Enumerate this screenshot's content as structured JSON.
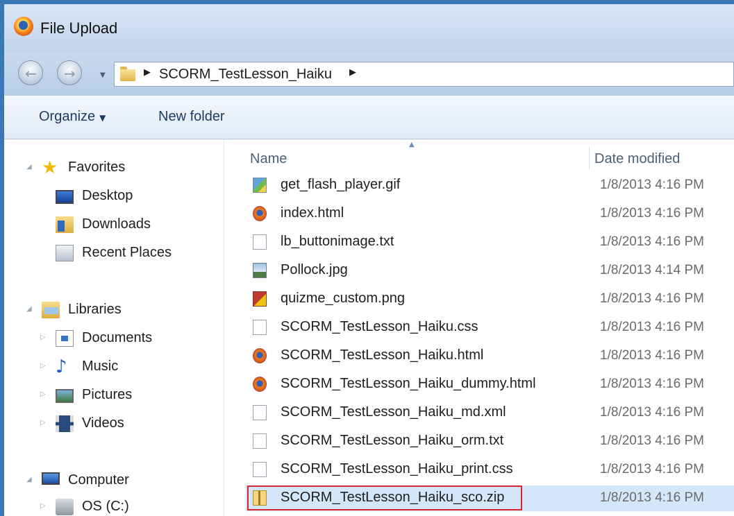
{
  "window": {
    "title": "File Upload",
    "app_icon": "firefox-icon"
  },
  "navigation": {
    "back_icon": "back-arrow-icon",
    "forward_icon": "forward-arrow-icon",
    "breadcrumb": [
      "SCORM_TestLesson_Haiku"
    ]
  },
  "toolbar": {
    "organize_label": "Organize",
    "new_folder_label": "New folder"
  },
  "sidebar": {
    "favorites": {
      "label": "Favorites",
      "icon": "star-icon",
      "items": [
        {
          "label": "Desktop",
          "icon": "desktop-icon"
        },
        {
          "label": "Downloads",
          "icon": "downloads-folder-icon"
        },
        {
          "label": "Recent Places",
          "icon": "recent-places-icon"
        }
      ]
    },
    "libraries": {
      "label": "Libraries",
      "icon": "libraries-icon",
      "items": [
        {
          "label": "Documents",
          "icon": "documents-icon"
        },
        {
          "label": "Music",
          "icon": "music-icon"
        },
        {
          "label": "Pictures",
          "icon": "pictures-icon"
        },
        {
          "label": "Videos",
          "icon": "videos-icon"
        }
      ]
    },
    "computer": {
      "label": "Computer",
      "icon": "computer-icon",
      "items": [
        {
          "label": "OS (C:)",
          "icon": "drive-icon"
        }
      ]
    }
  },
  "file_list": {
    "columns": {
      "name": "Name",
      "date_modified": "Date modified"
    },
    "sort_column": "Name",
    "files": [
      {
        "name": "get_flash_player.gif",
        "date": "1/8/2013 4:16 PM",
        "icon": "image-file-icon"
      },
      {
        "name": "index.html",
        "date": "1/8/2013 4:16 PM",
        "icon": "firefox-html-icon"
      },
      {
        "name": "lb_buttonimage.txt",
        "date": "1/8/2013 4:16 PM",
        "icon": "text-file-icon"
      },
      {
        "name": "Pollock.jpg",
        "date": "1/8/2013 4:14 PM",
        "icon": "jpg-file-icon"
      },
      {
        "name": "quizme_custom.png",
        "date": "1/8/2013 4:16 PM",
        "icon": "png-file-icon"
      },
      {
        "name": "SCORM_TestLesson_Haiku.css",
        "date": "1/8/2013 4:16 PM",
        "icon": "text-file-icon"
      },
      {
        "name": "SCORM_TestLesson_Haiku.html",
        "date": "1/8/2013 4:16 PM",
        "icon": "firefox-html-icon"
      },
      {
        "name": "SCORM_TestLesson_Haiku_dummy.html",
        "date": "1/8/2013 4:16 PM",
        "icon": "firefox-html-icon"
      },
      {
        "name": "SCORM_TestLesson_Haiku_md.xml",
        "date": "1/8/2013 4:16 PM",
        "icon": "text-file-icon"
      },
      {
        "name": "SCORM_TestLesson_Haiku_orm.txt",
        "date": "1/8/2013 4:16 PM",
        "icon": "text-file-icon"
      },
      {
        "name": "SCORM_TestLesson_Haiku_print.css",
        "date": "1/8/2013 4:16 PM",
        "icon": "text-file-icon"
      },
      {
        "name": "SCORM_TestLesson_Haiku_sco.zip",
        "date": "1/8/2013 4:16 PM",
        "icon": "zip-file-icon",
        "selected": true
      }
    ]
  },
  "colors": {
    "window_border": "#3b77b5",
    "selection": "#d4e7fa",
    "highlight_box": "#d7252f"
  }
}
